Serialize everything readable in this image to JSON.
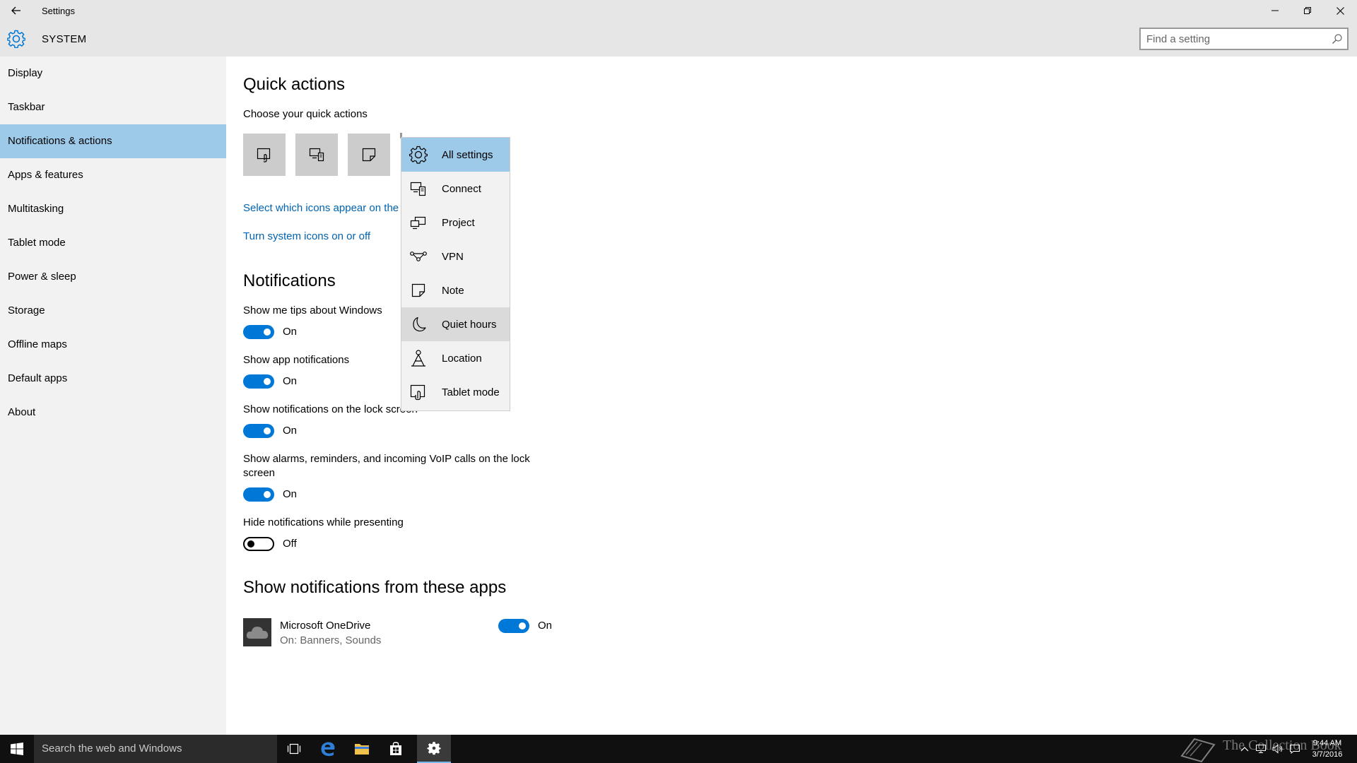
{
  "window": {
    "title": "Settings",
    "back_icon": "back-arrow-icon",
    "minimize_icon": "minimize-icon",
    "restore_icon": "restore-icon",
    "close_icon": "close-icon"
  },
  "header": {
    "icon": "gear-icon",
    "title": "SYSTEM",
    "search_placeholder": "Find a setting"
  },
  "sidebar": {
    "items": [
      {
        "label": "Display"
      },
      {
        "label": "Taskbar"
      },
      {
        "label": "Notifications & actions",
        "active": true
      },
      {
        "label": "Apps & features"
      },
      {
        "label": "Multitasking"
      },
      {
        "label": "Tablet mode"
      },
      {
        "label": "Power & sleep"
      },
      {
        "label": "Storage"
      },
      {
        "label": "Offline maps"
      },
      {
        "label": "Default apps"
      },
      {
        "label": "About"
      }
    ]
  },
  "quick_actions": {
    "heading": "Quick actions",
    "subheading": "Choose your quick actions",
    "tiles": [
      "tablet-mode-icon",
      "connect-icon",
      "note-icon"
    ],
    "link_icons": "Select which icons appear on the",
    "link_system": "Turn system icons on or off"
  },
  "dropdown": {
    "items": [
      {
        "label": "All settings",
        "icon": "gear-icon",
        "state": "selected"
      },
      {
        "label": "Connect",
        "icon": "connect-icon"
      },
      {
        "label": "Project",
        "icon": "project-icon"
      },
      {
        "label": "VPN",
        "icon": "vpn-icon"
      },
      {
        "label": "Note",
        "icon": "note-icon"
      },
      {
        "label": "Quiet hours",
        "icon": "moon-icon",
        "state": "hover"
      },
      {
        "label": "Location",
        "icon": "location-icon"
      },
      {
        "label": "Tablet mode",
        "icon": "tablet-mode-icon"
      }
    ]
  },
  "notifications": {
    "heading": "Notifications",
    "settings": [
      {
        "label": "Show me tips about Windows",
        "state": "On"
      },
      {
        "label": "Show app notifications",
        "state": "On"
      },
      {
        "label": "Show notifications on the lock screen",
        "state": "On"
      },
      {
        "label_line1": "Show alarms, reminders, and incoming VoIP calls on the lock",
        "label_line2": "screen",
        "state": "On"
      },
      {
        "label": "Hide notifications while presenting",
        "state": "Off"
      }
    ]
  },
  "apps": {
    "heading": "Show notifications from these apps",
    "items": [
      {
        "name": "Microsoft OneDrive",
        "detail": "On: Banners, Sounds",
        "state": "On",
        "icon": "onedrive-icon"
      }
    ]
  },
  "taskbar": {
    "search_text": "Search the web and Windows",
    "time": "9:44 AM",
    "date": "3/7/2016",
    "watermark": "The Collection Book"
  },
  "colors": {
    "accent": "#0078d7",
    "link": "#0063b1",
    "selection": "#9ecae9",
    "chrome": "#e6e6e6",
    "sidebar": "#f2f2f2",
    "taskbar": "#101010"
  }
}
